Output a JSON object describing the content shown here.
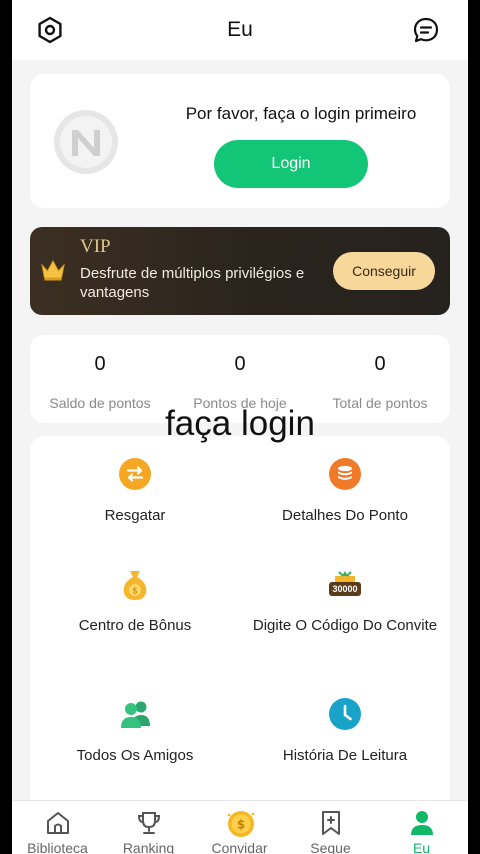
{
  "header": {
    "title": "Eu"
  },
  "login": {
    "message": "Por favor, faça o login primeiro",
    "button_label": "Login"
  },
  "vip": {
    "title": "VIP",
    "description": "Desfrute de múltiplos privilégios e vantagens",
    "button_label": "Conseguir"
  },
  "points": [
    {
      "value": "0",
      "label": "Saldo de pontos"
    },
    {
      "value": "0",
      "label": "Pontos de hoje"
    },
    {
      "value": "0",
      "label": "Total de pontos"
    }
  ],
  "overlay_caption": "faça login",
  "menu": [
    {
      "label": "Resgatar",
      "icon": "exchange-icon"
    },
    {
      "label": "Detalhes Do Ponto",
      "icon": "coin-stack-icon"
    },
    {
      "label": "Centro de Bônus",
      "icon": "bonus-bag-icon"
    },
    {
      "label": "Digite O Código Do Convite",
      "icon": "invite-code-icon",
      "badge": "30000"
    },
    {
      "label": "Todos Os Amigos",
      "icon": "friends-icon"
    },
    {
      "label": "História De Leitura",
      "icon": "clock-icon"
    }
  ],
  "tabs": [
    {
      "label": "Biblioteca",
      "icon": "home-icon",
      "active": false
    },
    {
      "label": "Ranking",
      "icon": "trophy-icon",
      "active": false
    },
    {
      "label": "Convidar",
      "icon": "coin-icon",
      "active": false
    },
    {
      "label": "Seque",
      "icon": "bookmark-add-icon",
      "active": false
    },
    {
      "label": "Eu",
      "icon": "user-icon",
      "active": true
    }
  ],
  "colors": {
    "accent_green": "#13c677",
    "vip_gold": "#e1c58f",
    "vip_button": "#f8d79b",
    "orange": "#f5a623",
    "teal": "#1aa3c9"
  }
}
